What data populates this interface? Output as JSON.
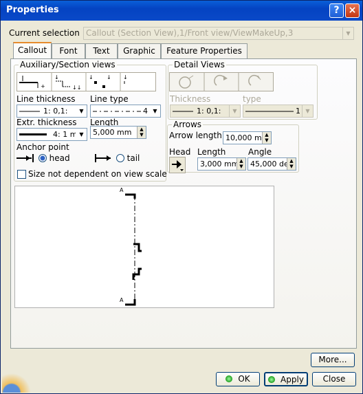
{
  "window": {
    "title": "Properties",
    "help": "?",
    "close": "×"
  },
  "current_selection": {
    "label": "Current selection :",
    "value": "Callout (Section View),1/Front view/ViewMakeUp,3"
  },
  "tabs": [
    {
      "label": "Callout",
      "active": true
    },
    {
      "label": "Font"
    },
    {
      "label": "Text"
    },
    {
      "label": "Graphic"
    },
    {
      "label": "Feature Properties"
    }
  ],
  "aux_section": {
    "title": "Auxiliary/Section views",
    "line_thickness": {
      "label": "Line thickness",
      "value": "1: 0,1:"
    },
    "line_type": {
      "label": "Line type",
      "value": "4"
    },
    "extr_thickness": {
      "label": "Extr. thickness",
      "value": "4: 1 m"
    },
    "length": {
      "label": "Length",
      "value": "5,000 mm"
    },
    "anchor": {
      "label": "Anchor point",
      "head": "head",
      "tail": "tail",
      "selected": "head"
    },
    "size_checkbox": {
      "label": "Size not dependent on view scale",
      "checked": false
    }
  },
  "detail_views": {
    "title": "Detail Views",
    "thickness": {
      "label": "Thickness",
      "value": "1: 0,1:"
    },
    "type": {
      "label": "type",
      "value": "1"
    }
  },
  "arrows": {
    "title": "Arrows",
    "arrow_length": {
      "label": "Arrow length:",
      "value": "10,000 mr"
    },
    "head": {
      "label": "Head"
    },
    "length": {
      "label": "Length",
      "value": "3,000 mm"
    },
    "angle": {
      "label": "Angle",
      "value": "45,000 de"
    }
  },
  "preview": {
    "section_label_top": "A",
    "section_label_bottom": "A"
  },
  "buttons": {
    "more": "More...",
    "ok": "OK",
    "apply": "Apply",
    "close": "Close"
  }
}
